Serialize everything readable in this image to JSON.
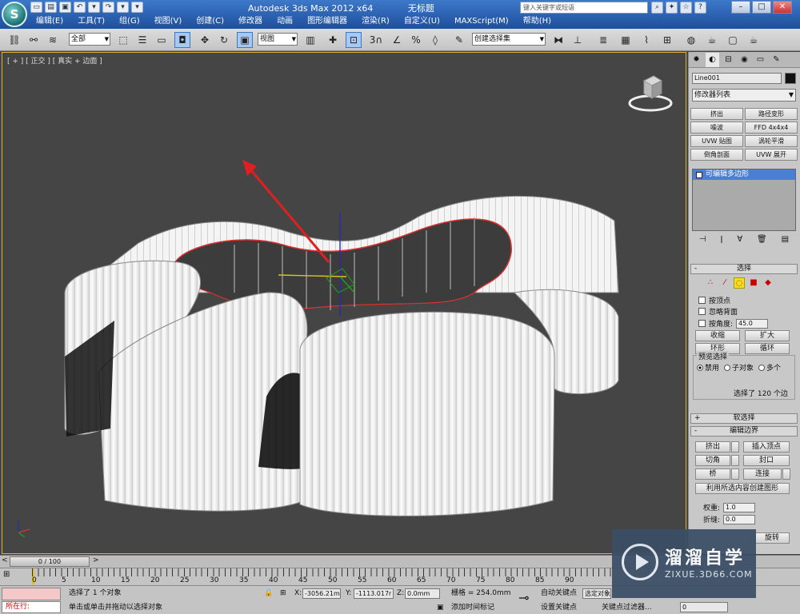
{
  "app": {
    "title": "Autodesk 3ds Max  2012 x64",
    "doc": "无标题"
  },
  "menu": [
    "编辑(E)",
    "工具(T)",
    "组(G)",
    "视图(V)",
    "创建(C)",
    "修改器",
    "动画",
    "图形编辑器",
    "渲染(R)",
    "自定义(U)",
    "MAXScript(M)",
    "帮助(H)"
  ],
  "search_placeholder": "键入关键字或短语",
  "toolbar": {
    "filter": "全部",
    "ref_coord": "视图",
    "named_sel": "创建选择集",
    "snap_label": "3"
  },
  "viewport": {
    "label": "[ + ] [ 正交 ] [ 真实 + 边面 ]"
  },
  "cmd": {
    "object_name": "Line001",
    "modifier_list": "修改器列表",
    "modifiers": [
      "挤出",
      "路径变形",
      "噪波",
      "FFD 4x4x4",
      "UVW 贴图",
      "涡轮平滑",
      "倒角剖面",
      "UVW 展开"
    ],
    "stack_item": "可编辑多边形",
    "selection": {
      "title": "选择",
      "by_vertex": "按顶点",
      "ignore_back": "忽略背面",
      "by_angle": "按角度:",
      "angle_val": "45.0",
      "shrink": "收缩",
      "grow": "扩大",
      "ring": "环形",
      "loop": "循环",
      "preview_title": "预览选择",
      "preview_opts": [
        "禁用",
        "子对象",
        "多个"
      ],
      "count": "选择了 120 个边"
    },
    "soft_sel": "软选择",
    "edit_edges": {
      "title": "编辑边界",
      "extrude": "挤出",
      "insert_vertex": "插入顶点",
      "chamfer": "切角",
      "cap": "封口",
      "bridge": "桥",
      "connect": "连接",
      "create_shape": "利用所选内容创建图形",
      "weight_label": "权重:",
      "weight": "1.0",
      "crease_label": "折缝:",
      "crease": "0.0",
      "rotate": "旋转"
    }
  },
  "timeline": {
    "frame": "0 / 100",
    "ticks": [
      "0",
      "5",
      "10",
      "15",
      "20",
      "25",
      "30",
      "35",
      "40",
      "45",
      "50",
      "55",
      "60",
      "65",
      "70",
      "75",
      "80",
      "85",
      "90"
    ]
  },
  "status": {
    "maxscript": "所在行:",
    "selected": "选择了 1 个对象",
    "prompt": "单击或单击并拖动以选择对象",
    "x_label": "X:",
    "x": "-3056.21m",
    "y_label": "Y:",
    "y": "-1113.017r",
    "z_label": "Z:",
    "z": "0.0mm",
    "grid": "栅格 = 254.0mm",
    "add_tag": "添加时间标记",
    "auto_key": "自动关键点",
    "set_key": "设置关键点",
    "selected_obj": "选定对象",
    "key_filter": "关键点过滤器...",
    "frame_val": "0"
  },
  "watermark": {
    "title": "溜溜自学",
    "url": "ZIXUE.3D66.COM"
  },
  "colors": {
    "selection_edge": "#e03030",
    "arrow": "#e02020",
    "active_stack": "#4a7fd4"
  }
}
